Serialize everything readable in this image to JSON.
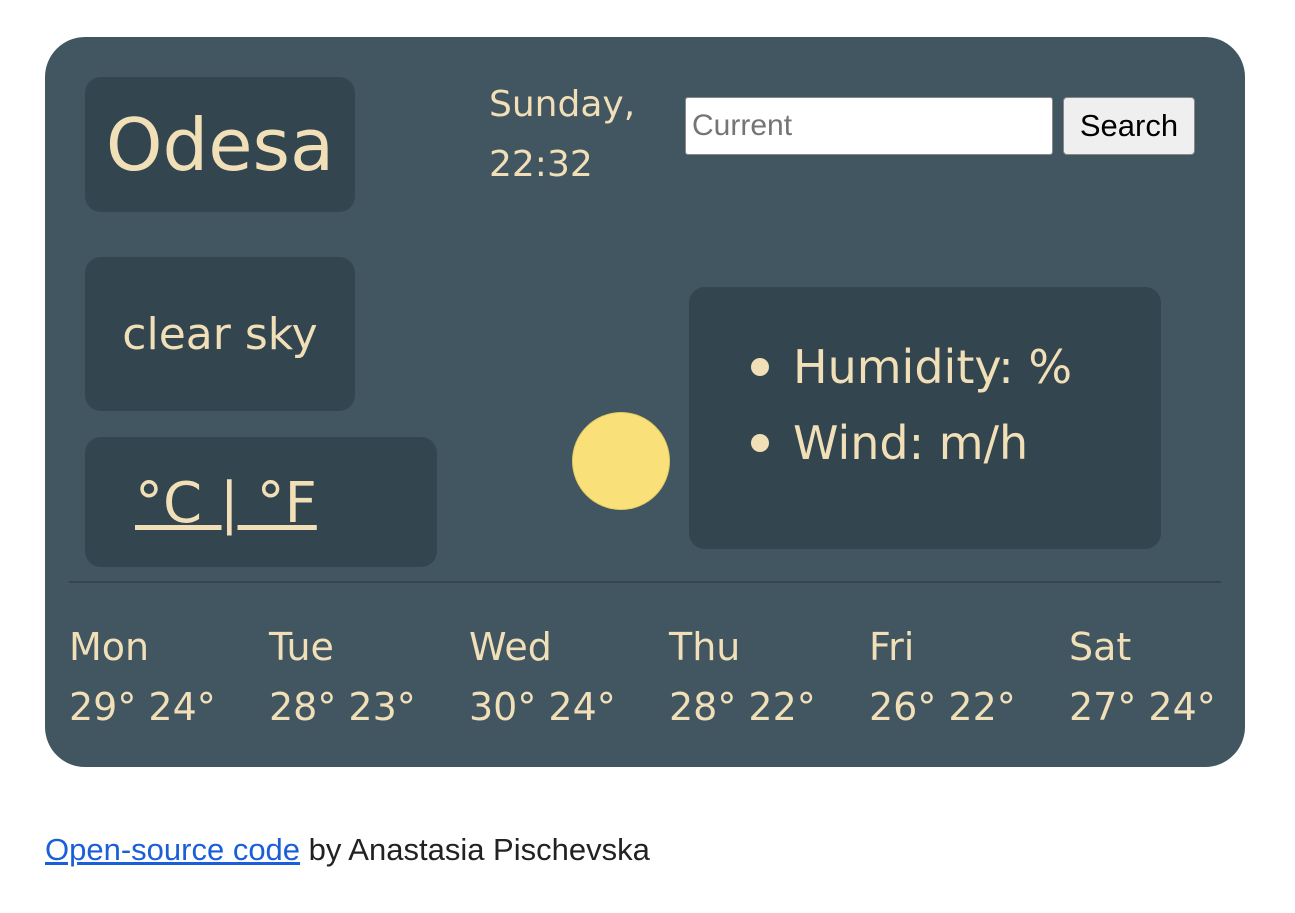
{
  "weather": {
    "city": "Odesa",
    "day": "Sunday,",
    "time": "22:32",
    "description": "clear sky",
    "units": "°C | °F",
    "icon": "sun-icon",
    "details": {
      "humidity": "Humidity: %",
      "wind": "Wind: m/h"
    }
  },
  "search": {
    "placeholder": "Current",
    "value": "",
    "button_label": "Search"
  },
  "forecast": [
    {
      "day": "Mon",
      "temps": "29° 24°"
    },
    {
      "day": "Tue",
      "temps": "28° 23°"
    },
    {
      "day": "Wed",
      "temps": "30° 24°"
    },
    {
      "day": "Thu",
      "temps": "28° 22°"
    },
    {
      "day": "Fri",
      "temps": "26° 22°"
    },
    {
      "day": "Sat",
      "temps": "27° 24°"
    }
  ],
  "footer": {
    "link_label": "Open-source code",
    "author_text": " by Anastasia Pischevska"
  },
  "colors": {
    "card_background": "#415661",
    "panel_background": "#33454e",
    "text": "#f1dfb8",
    "sun": "#f9e079",
    "link": "#1a5ed8"
  }
}
